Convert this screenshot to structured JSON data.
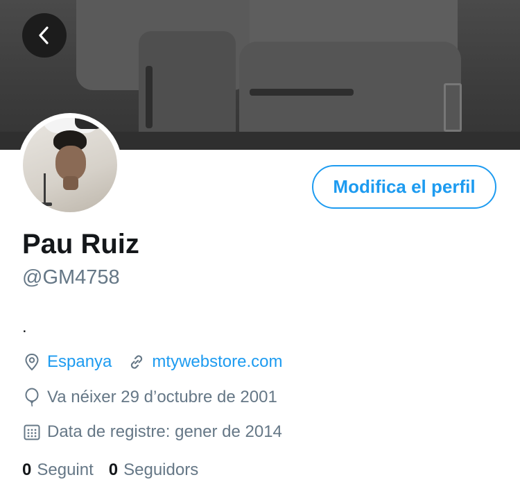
{
  "header": {
    "back_icon": "chevron-left-icon"
  },
  "profile": {
    "name": "Pau Ruiz",
    "handle": "@GM4758",
    "bio": ".",
    "edit_button_label": "Modifica el perfil",
    "location": "Espanya",
    "website": "mtywebstore.com",
    "birthday": "Va néixer 29 d’octubre de 2001",
    "joined": "Data de registre: gener de 2014"
  },
  "stats": {
    "following_count": "0",
    "following_label": "Seguint",
    "followers_count": "0",
    "followers_label": "Seguidors"
  },
  "colors": {
    "accent": "#1d9bf0",
    "text": "#14171a",
    "secondary": "#657786"
  }
}
